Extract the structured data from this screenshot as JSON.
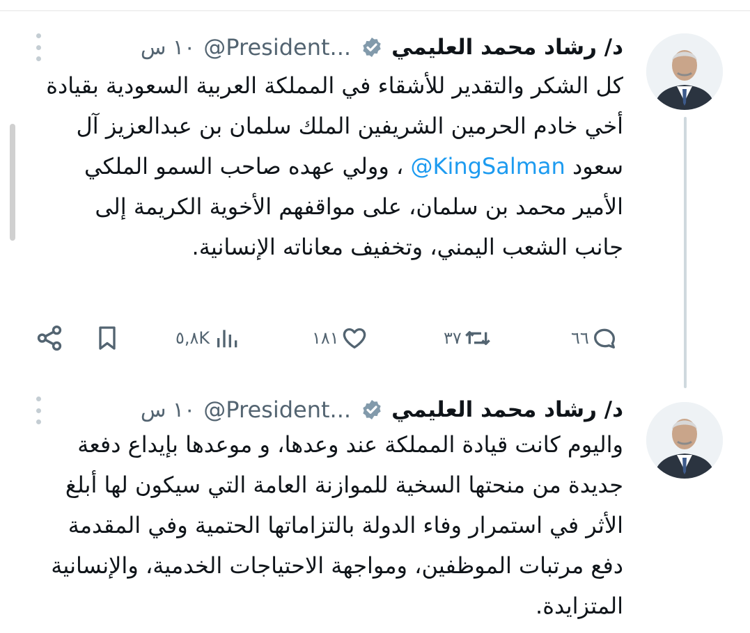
{
  "tweets": [
    {
      "author_name": "د/ رشاد محمد العليمي",
      "handle": "@President...",
      "time": "١٠ س",
      "text_before_mention": "كل الشكر والتقدير للأشقاء في المملكة العربية السعودية بقيادة أخي خادم الحرمين الشريفين الملك سلمان بن عبدالعزيز آل سعود",
      "mention": "@KingSalman",
      "text_after_mention": "، وولي عهده صاحب السمو الملكي الأمير محمد بن سلمان، على مواقفهم الأخوية الكريمة إلى جانب الشعب اليمني، وتخفيف معاناته الإنسانية.",
      "stats": {
        "replies": "٦٦",
        "retweets": "٣٧",
        "likes": "١٨١",
        "views": "٥,٨K"
      }
    },
    {
      "author_name": "د/ رشاد محمد العليمي",
      "handle": "@President...",
      "time": "١٠ س",
      "text": "واليوم كانت قيادة المملكة عند وعدها، و موعدها بإيداع دفعة جديدة من منحتها السخية للموازنة العامة التي سيكون لها أبلغ الأثر في استمرار وفاء الدولة بالتزاماتها الحتمية وفي المقدمة دفع مرتبات الموظفين، ومواجهة الاحتياجات الخدمية، والإنسانية المتزايدة."
    }
  ],
  "colors": {
    "text": "#0f1419",
    "secondary": "#536471",
    "link": "#1d9bf0",
    "thread_line": "#cfd9de"
  },
  "icons": [
    "more-icon",
    "verified-badge-icon",
    "reply-icon",
    "retweet-icon",
    "like-icon",
    "views-icon",
    "bookmark-icon",
    "share-icon"
  ]
}
